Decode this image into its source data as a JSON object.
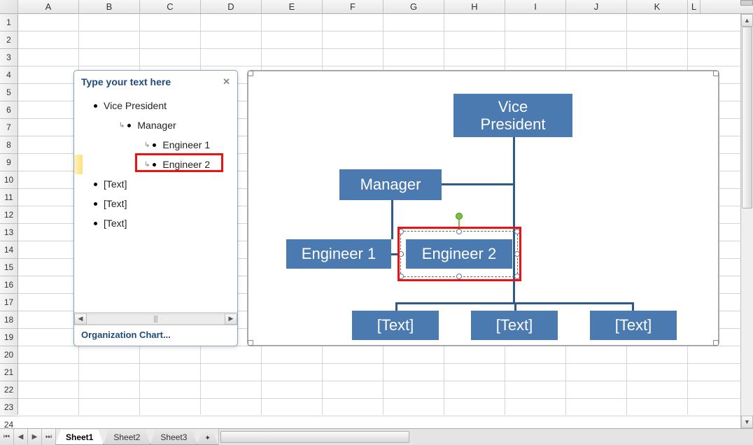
{
  "columns": [
    "A",
    "B",
    "C",
    "D",
    "E",
    "F",
    "G",
    "H",
    "I",
    "J",
    "K",
    "L"
  ],
  "rows": [
    "1",
    "2",
    "3",
    "4",
    "5",
    "6",
    "7",
    "8",
    "9",
    "10",
    "11",
    "12",
    "13",
    "14",
    "15",
    "16",
    "17",
    "18",
    "19",
    "20",
    "21",
    "22",
    "23",
    "24"
  ],
  "textPane": {
    "title": "Type your text here",
    "items": [
      {
        "label": "Vice President",
        "level": 0,
        "type": "bullet"
      },
      {
        "label": "Manager",
        "level": 1,
        "type": "arrow"
      },
      {
        "label": "Engineer 1",
        "level": 2,
        "type": "arrow"
      },
      {
        "label": "Engineer 2",
        "level": 2,
        "type": "arrow",
        "highlighted": true
      },
      {
        "label": "[Text]",
        "level": 0,
        "type": "bullet"
      },
      {
        "label": "[Text]",
        "level": 0,
        "type": "bullet"
      },
      {
        "label": "[Text]",
        "level": 0,
        "type": "bullet"
      }
    ],
    "footer": "Organization Chart..."
  },
  "orgChart": {
    "vp": "Vice\nPresident",
    "manager": "Manager",
    "eng1": "Engineer 1",
    "eng2": "Engineer 2",
    "text1": "[Text]",
    "text2": "[Text]",
    "text3": "[Text]"
  },
  "sheets": [
    "Sheet1",
    "Sheet2",
    "Sheet3"
  ],
  "activeSheet": "Sheet1"
}
